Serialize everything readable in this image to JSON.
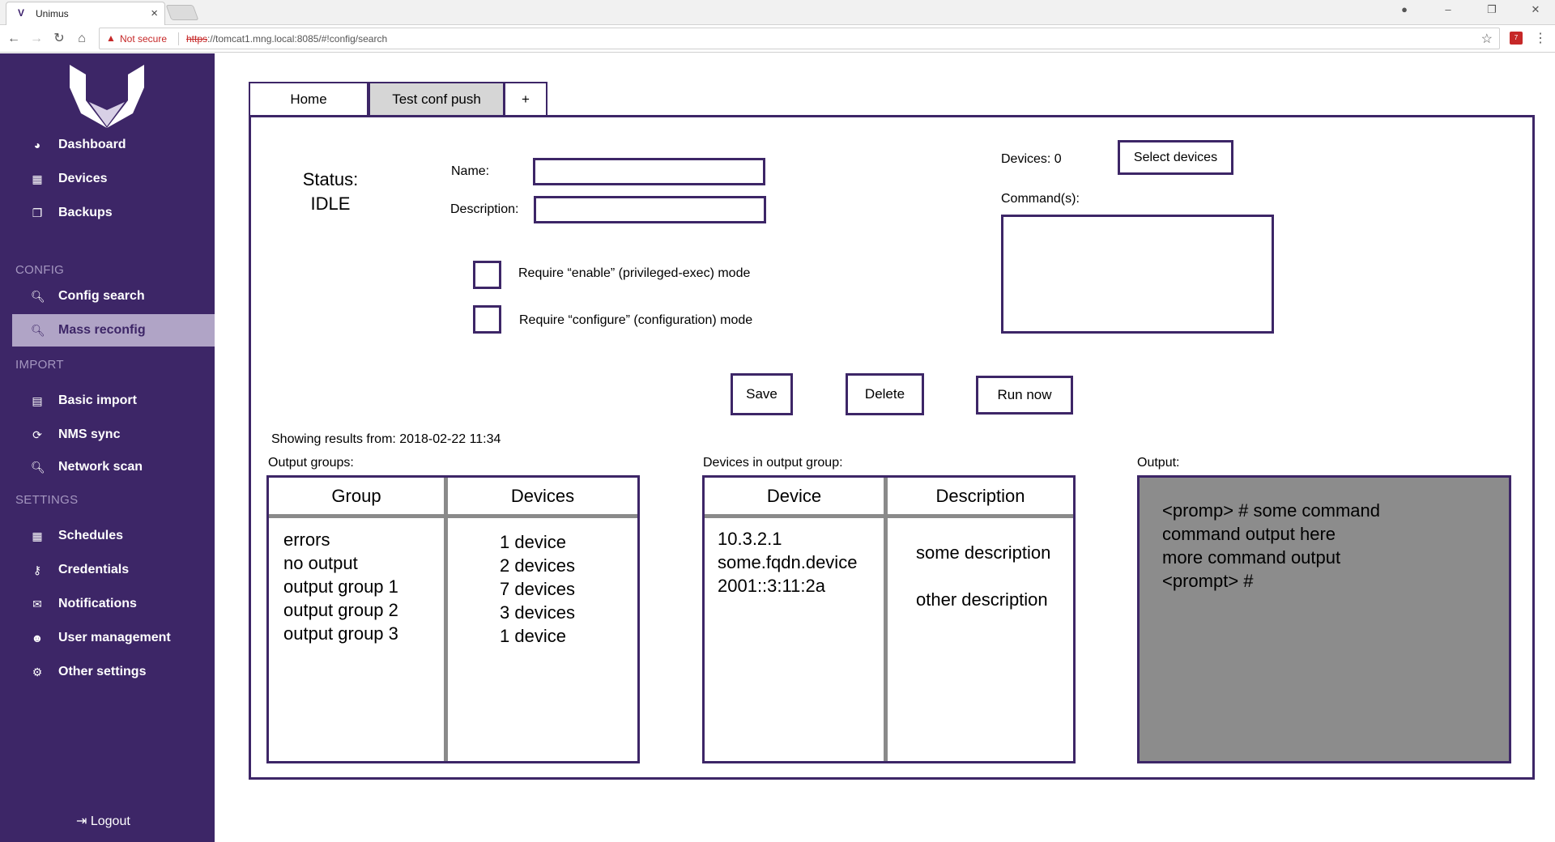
{
  "browser": {
    "tab_title": "Unimus",
    "not_secure": "Not secure",
    "url_scheme": "https",
    "url_rest": "://tomcat1.mng.local:8085/#!config/search"
  },
  "sidebar": {
    "items": [
      {
        "label": "Dashboard",
        "icon": "dashboard-icon"
      },
      {
        "label": "Devices",
        "icon": "devices-icon"
      },
      {
        "label": "Backups",
        "icon": "backups-icon"
      }
    ],
    "section_config": "CONFIG",
    "config_items": [
      {
        "label": "Config search",
        "icon": "search-icon"
      },
      {
        "label": "Mass reconfig",
        "icon": "search-icon"
      }
    ],
    "section_import": "IMPORT",
    "import_items": [
      {
        "label": "Basic import",
        "icon": "file-icon"
      },
      {
        "label": "NMS sync",
        "icon": "sync-icon"
      },
      {
        "label": "Network scan",
        "icon": "search-icon"
      }
    ],
    "section_settings": "SETTINGS",
    "settings_items": [
      {
        "label": "Schedules",
        "icon": "calendar-icon"
      },
      {
        "label": "Credentials",
        "icon": "key-icon"
      },
      {
        "label": "Notifications",
        "icon": "envelope-icon"
      },
      {
        "label": "User management",
        "icon": "users-icon"
      },
      {
        "label": "Other settings",
        "icon": "gears-icon"
      }
    ],
    "logout": "Logout"
  },
  "tabs": {
    "home": "Home",
    "test_conf_push": "Test conf push",
    "add": "+"
  },
  "form": {
    "status_label": "Status:",
    "status_value": "IDLE",
    "name_label": "Name:",
    "name_value": "",
    "description_label": "Description:",
    "description_value": "",
    "require_enable": "Require “enable” (privileged-exec) mode",
    "require_configure": "Require “configure” (configuration) mode",
    "devices_count": "Devices: 0",
    "select_devices": "Select devices",
    "commands_label": "Command(s):",
    "save": "Save",
    "delete": "Delete",
    "run_now": "Run now"
  },
  "results": {
    "showing_from": "Showing results from: 2018-02-22 11:34",
    "output_groups_label": "Output groups:",
    "group_col": "Group",
    "devices_col": "Devices",
    "groups": [
      "errors",
      "no output",
      "output group 1",
      "output group 2",
      "output group 3"
    ],
    "group_devices": [
      "1 device",
      "2 devices",
      "7 devices",
      "3 devices",
      "1 device"
    ],
    "devices_in_group_label": "Devices in output group:",
    "device_col": "Device",
    "description_col": "Description",
    "devices": [
      "10.3.2.1",
      "some.fqdn.device",
      "2001::3:11:2a"
    ],
    "descriptions": [
      "some description",
      "other description"
    ],
    "output_label": "Output:",
    "output_lines": [
      "<promp> # some command",
      "command output here",
      "more command output",
      "<prompt> #"
    ]
  },
  "colors": {
    "sidebar_bg": "#3d2667",
    "accent": "#3d2667",
    "active_item_bg": "#b0a4c6",
    "output_bg": "#8c8c8c"
  }
}
